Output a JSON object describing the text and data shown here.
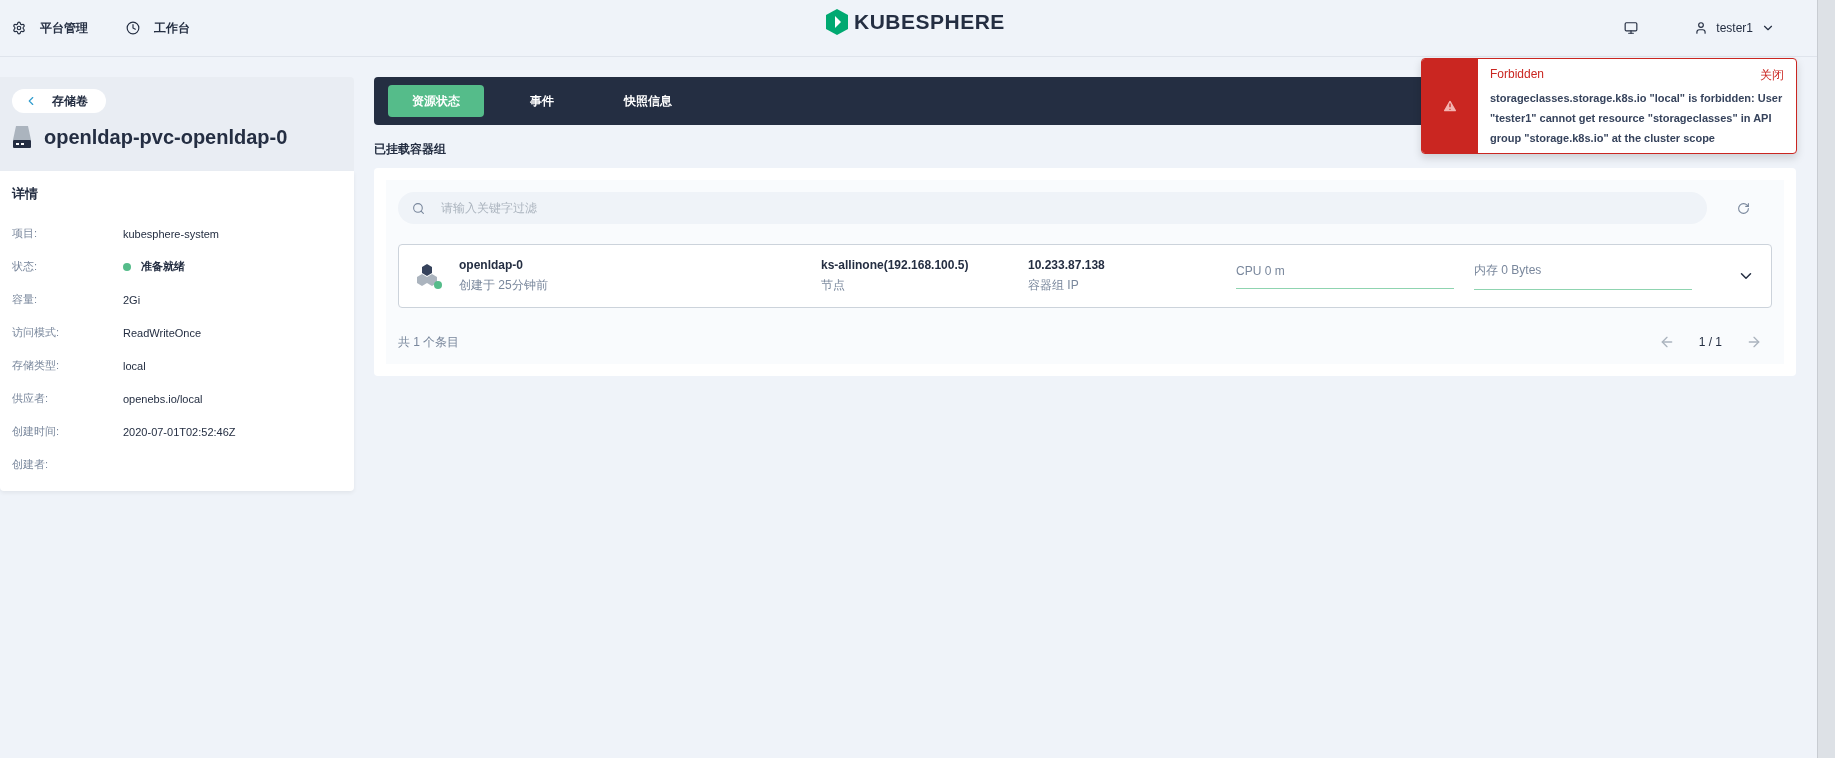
{
  "nav": [
    {
      "kind": "gear",
      "label": "平台管理"
    },
    {
      "kind": "clock",
      "label": "工作台"
    }
  ],
  "logo": {
    "text": "KUBESPHERE"
  },
  "user": {
    "name": "tester1"
  },
  "back": {
    "label": "存储卷"
  },
  "volume": {
    "name": "openldap-pvc-openldap-0"
  },
  "details": {
    "title": "详情",
    "rows": [
      {
        "label": "项目:",
        "value": "kubesphere-system"
      },
      {
        "label": "状态:",
        "value": "准备就绪",
        "color": "#55bc8a"
      },
      {
        "label": "容量:",
        "value": "2Gi"
      },
      {
        "label": "访问模式:",
        "value": "ReadWriteOnce"
      },
      {
        "label": "存储类型:",
        "value": "local"
      },
      {
        "label": "供应者:",
        "value": "openebs.io/local"
      },
      {
        "label": "创建时间:",
        "value": "2020-07-01T02:52:46Z"
      },
      {
        "label": "创建者:"
      }
    ]
  },
  "tabs": [
    {
      "label": "资源状态",
      "selected": true
    },
    {
      "label": "事件",
      "selected": false
    },
    {
      "label": "快照信息",
      "selected": false
    }
  ],
  "section_title": "已挂载容器组",
  "search": {
    "placeholder": "请输入关键字过滤"
  },
  "pods": [
    {
      "name": "openldap-0",
      "created": "创建于 25分钟前",
      "node": "ks-allinone(192.168.100.5)",
      "node_label": "节点",
      "ip": "10.233.87.138",
      "ip_label": "容器组 IP",
      "cpu": "CPU 0 m",
      "memory": "内存 0 Bytes",
      "color": "#55bc8a"
    }
  ],
  "total": "共 1 个条目",
  "page": "1 / 1",
  "toast": {
    "title": "Forbidden",
    "close": "关闭",
    "message": "storageclasses.storage.k8s.io \"local\" is forbidden: User \"tester1\" cannot get resource \"storageclasses\" in API group \"storage.k8s.io\" at the cluster scope"
  }
}
